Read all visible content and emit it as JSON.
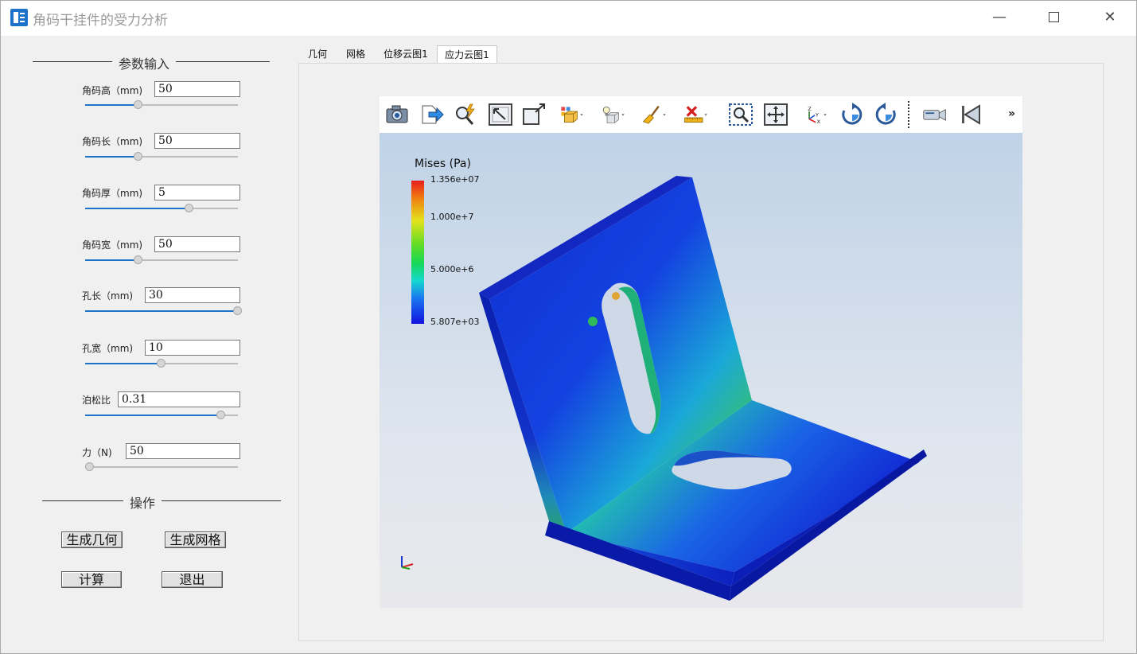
{
  "window": {
    "title": "角码干挂件的受力分析",
    "min_symbol": "—",
    "close_symbol": "✕"
  },
  "params": {
    "section_title": "参数输入",
    "items": [
      {
        "label": "角码高（mm)",
        "value": "50",
        "slider": 0.35
      },
      {
        "label": "角码长（mm)",
        "value": "50",
        "slider": 0.35
      },
      {
        "label": "角码厚（mm)",
        "value": "5",
        "slider": 0.68
      },
      {
        "label": "角码宽（mm)",
        "value": "50",
        "slider": 0.35
      },
      {
        "label": "孔长（mm)",
        "value": "30",
        "slider": 1.0
      },
      {
        "label": "孔宽（mm)",
        "value": "10",
        "slider": 0.5
      },
      {
        "label": "泊松比",
        "value": "0.31",
        "slider": 0.89
      },
      {
        "label": "力（N)",
        "value": "50",
        "slider": 0.03
      }
    ]
  },
  "operations": {
    "section_title": "操作",
    "generate_geometry": "生成几何",
    "generate_mesh": "生成网格",
    "compute": "计算",
    "exit": "退出"
  },
  "tabs": [
    {
      "label": "几何"
    },
    {
      "label": "网格"
    },
    {
      "label": "位移云图1"
    },
    {
      "label": "应力云图1",
      "active": true
    }
  ],
  "toolbar": {
    "icons": [
      "camera-icon",
      "export-icon",
      "zoom-probe-icon",
      "fit-view-icon",
      "zoom-extent-icon",
      "render-mode-icon",
      "lighting-icon",
      "clean-icon",
      "measure-delete-icon",
      "zoom-box-icon",
      "pan-icon",
      "axes-orient-icon",
      "rotate-cw-icon",
      "rotate-ccw-icon",
      "record-camera-icon",
      "first-frame-icon"
    ],
    "more": "»"
  },
  "legend": {
    "title": "Mises (Pa)",
    "max": "1.356e+07",
    "tick_high": "1.000e+7",
    "tick_mid": "5.000e+6",
    "min": "5.807e+03"
  },
  "colors": {
    "accent": "#1e73c8",
    "stress_low": "#1212e0",
    "stress_high": "#e81c1c"
  }
}
